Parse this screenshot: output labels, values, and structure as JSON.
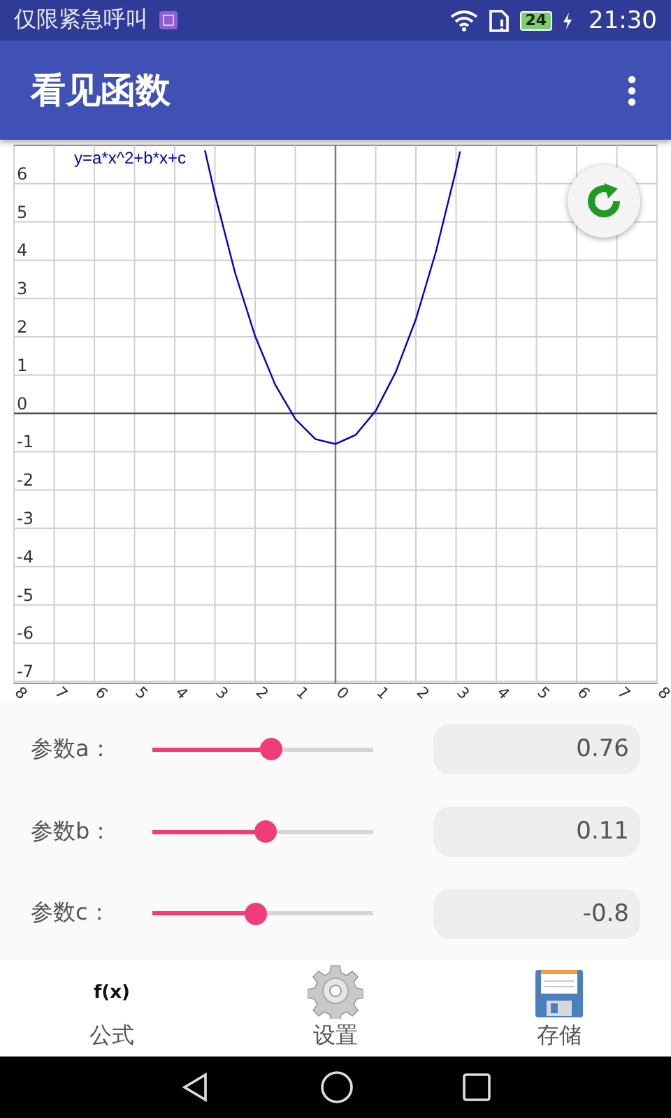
{
  "status_bar": {
    "carrier": "仅限紧急呼叫",
    "battery": "24",
    "time": "21:30"
  },
  "app_bar": {
    "title": "看见函数"
  },
  "graph": {
    "chart_data": {
      "type": "line",
      "grid": true,
      "xlim": [
        -8,
        8
      ],
      "ylim": [
        -7.05,
        7
      ],
      "xticks": [
        {
          "value": -8,
          "label": "8"
        },
        {
          "value": -7,
          "label": "7"
        },
        {
          "value": -6,
          "label": "6"
        },
        {
          "value": -5,
          "label": "5"
        },
        {
          "value": -4,
          "label": "4"
        },
        {
          "value": -3,
          "label": "3"
        },
        {
          "value": -2,
          "label": "2"
        },
        {
          "value": -1,
          "label": "1"
        },
        {
          "value": 0,
          "label": "0"
        },
        {
          "value": 1,
          "label": "1"
        },
        {
          "value": 2,
          "label": "2"
        },
        {
          "value": 3,
          "label": "3"
        },
        {
          "value": 4,
          "label": "4"
        },
        {
          "value": 5,
          "label": "5"
        },
        {
          "value": 6,
          "label": "6"
        },
        {
          "value": 7,
          "label": "7"
        },
        {
          "value": 8,
          "label": "8"
        }
      ],
      "yticks": [
        6,
        5,
        4,
        3,
        2,
        1,
        0,
        -1,
        -2,
        -3,
        -4,
        -5,
        -6,
        -7
      ],
      "x": [
        -3.25,
        -3,
        -2.5,
        -2,
        -1.5,
        -1,
        -0.5,
        0,
        0.5,
        1,
        1.5,
        2,
        2.5,
        3,
        3.1
      ],
      "series": [
        {
          "name": "y=a*x^2+b*x+c",
          "color": "#0000cc",
          "values": [
            6.87,
            5.71,
            3.68,
            2.02,
            0.75,
            -0.15,
            -0.67,
            -0.8,
            -0.56,
            0.07,
            1.08,
            2.46,
            4.23,
            6.37,
            6.84
          ]
        }
      ]
    }
  },
  "params": [
    {
      "label": "参数a：",
      "level": 0.54,
      "value": "0.76"
    },
    {
      "label": "参数b：",
      "level": 0.51,
      "value": "0.11"
    },
    {
      "label": "参数c：",
      "level": 0.47,
      "value": "-0.8"
    }
  ],
  "bottom_nav": [
    {
      "kind": "formula",
      "icon_text": "f(x)",
      "label": "公式"
    },
    {
      "kind": "settings",
      "label": "设置"
    },
    {
      "kind": "save",
      "label": "存储"
    }
  ]
}
